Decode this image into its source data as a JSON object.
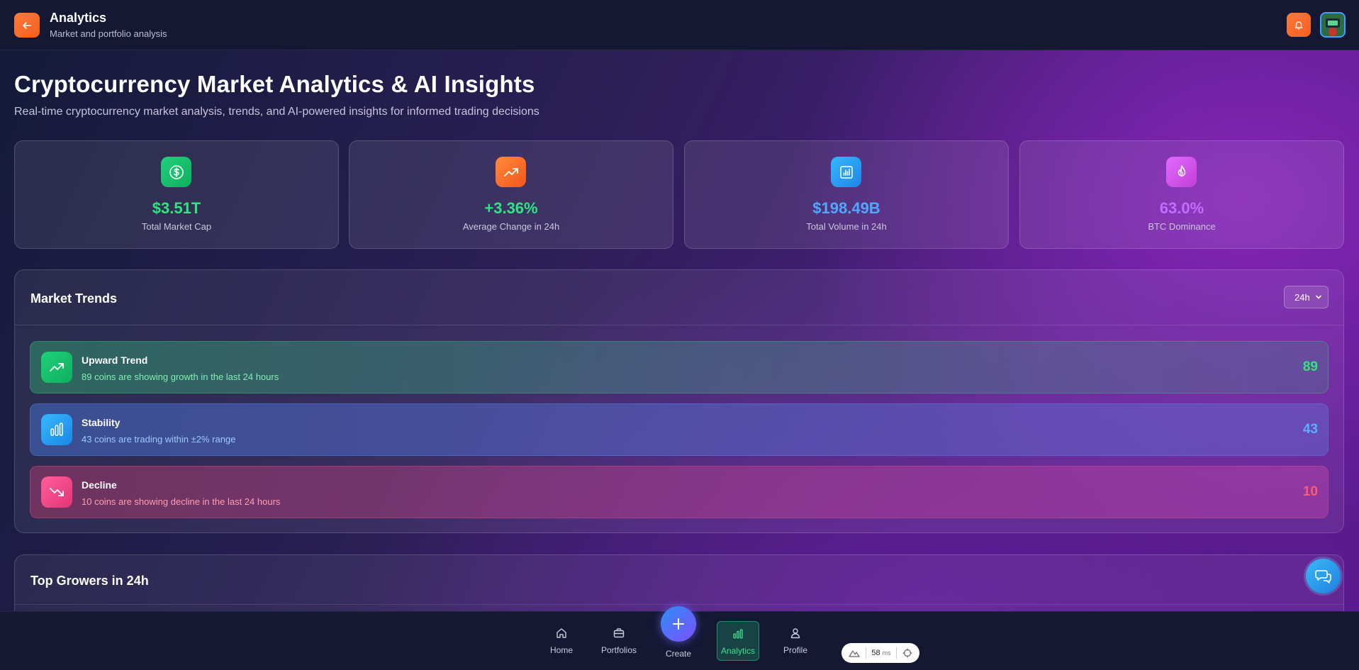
{
  "header": {
    "title": "Analytics",
    "subtitle": "Market and portfolio analysis",
    "back_icon": "arrow-left-icon",
    "bell_icon": "bell-icon"
  },
  "page": {
    "title": "Cryptocurrency Market Analytics & AI Insights",
    "subtitle": "Real-time cryptocurrency market analysis, trends, and AI-powered insights for informed trading decisions"
  },
  "stats": [
    {
      "icon": "dollar-icon",
      "value": "$3.51T",
      "label": "Total Market Cap",
      "value_color": "#2ee57f"
    },
    {
      "icon": "trending-up-icon",
      "value": "+3.36%",
      "label": "Average Change in 24h",
      "value_color": "#2ee57f"
    },
    {
      "icon": "bar-chart-icon",
      "value": "$198.49B",
      "label": "Total Volume in 24h",
      "value_color": "#4ea8ff"
    },
    {
      "icon": "flame-icon",
      "value": "63.0%",
      "label": "BTC Dominance",
      "value_color": "#c56cff"
    }
  ],
  "market_trends": {
    "title": "Market Trends",
    "range_selected": "24h",
    "rows": [
      {
        "name": "Upward Trend",
        "description": "89 coins are showing growth in the last 24 hours",
        "count": "89",
        "color": "#2ee57f",
        "desc_color": "#7ff0b0",
        "icon": "trending-up-icon"
      },
      {
        "name": "Stability",
        "description": "43 coins are trading within ±2% range",
        "count": "43",
        "color": "#5ab0ff",
        "desc_color": "#9ccaff",
        "icon": "bar-chart-icon"
      },
      {
        "name": "Decline",
        "description": "10 coins are showing decline in the last 24 hours",
        "count": "10",
        "color": "#ff5a6e",
        "desc_color": "#ff9fb0",
        "icon": "trending-down-icon"
      }
    ]
  },
  "top_growers": {
    "title": "Top Growers in 24h"
  },
  "nav": {
    "home": "Home",
    "portfolios": "Portfolios",
    "create": "Create",
    "analytics": "Analytics",
    "profile": "Profile"
  },
  "perf": {
    "value": "58",
    "unit": "ms"
  },
  "colors": {
    "accent_orange": "#f25f1f",
    "accent_green": "#2ee57f",
    "accent_blue": "#4ea8ff",
    "accent_purple": "#c56cff"
  }
}
